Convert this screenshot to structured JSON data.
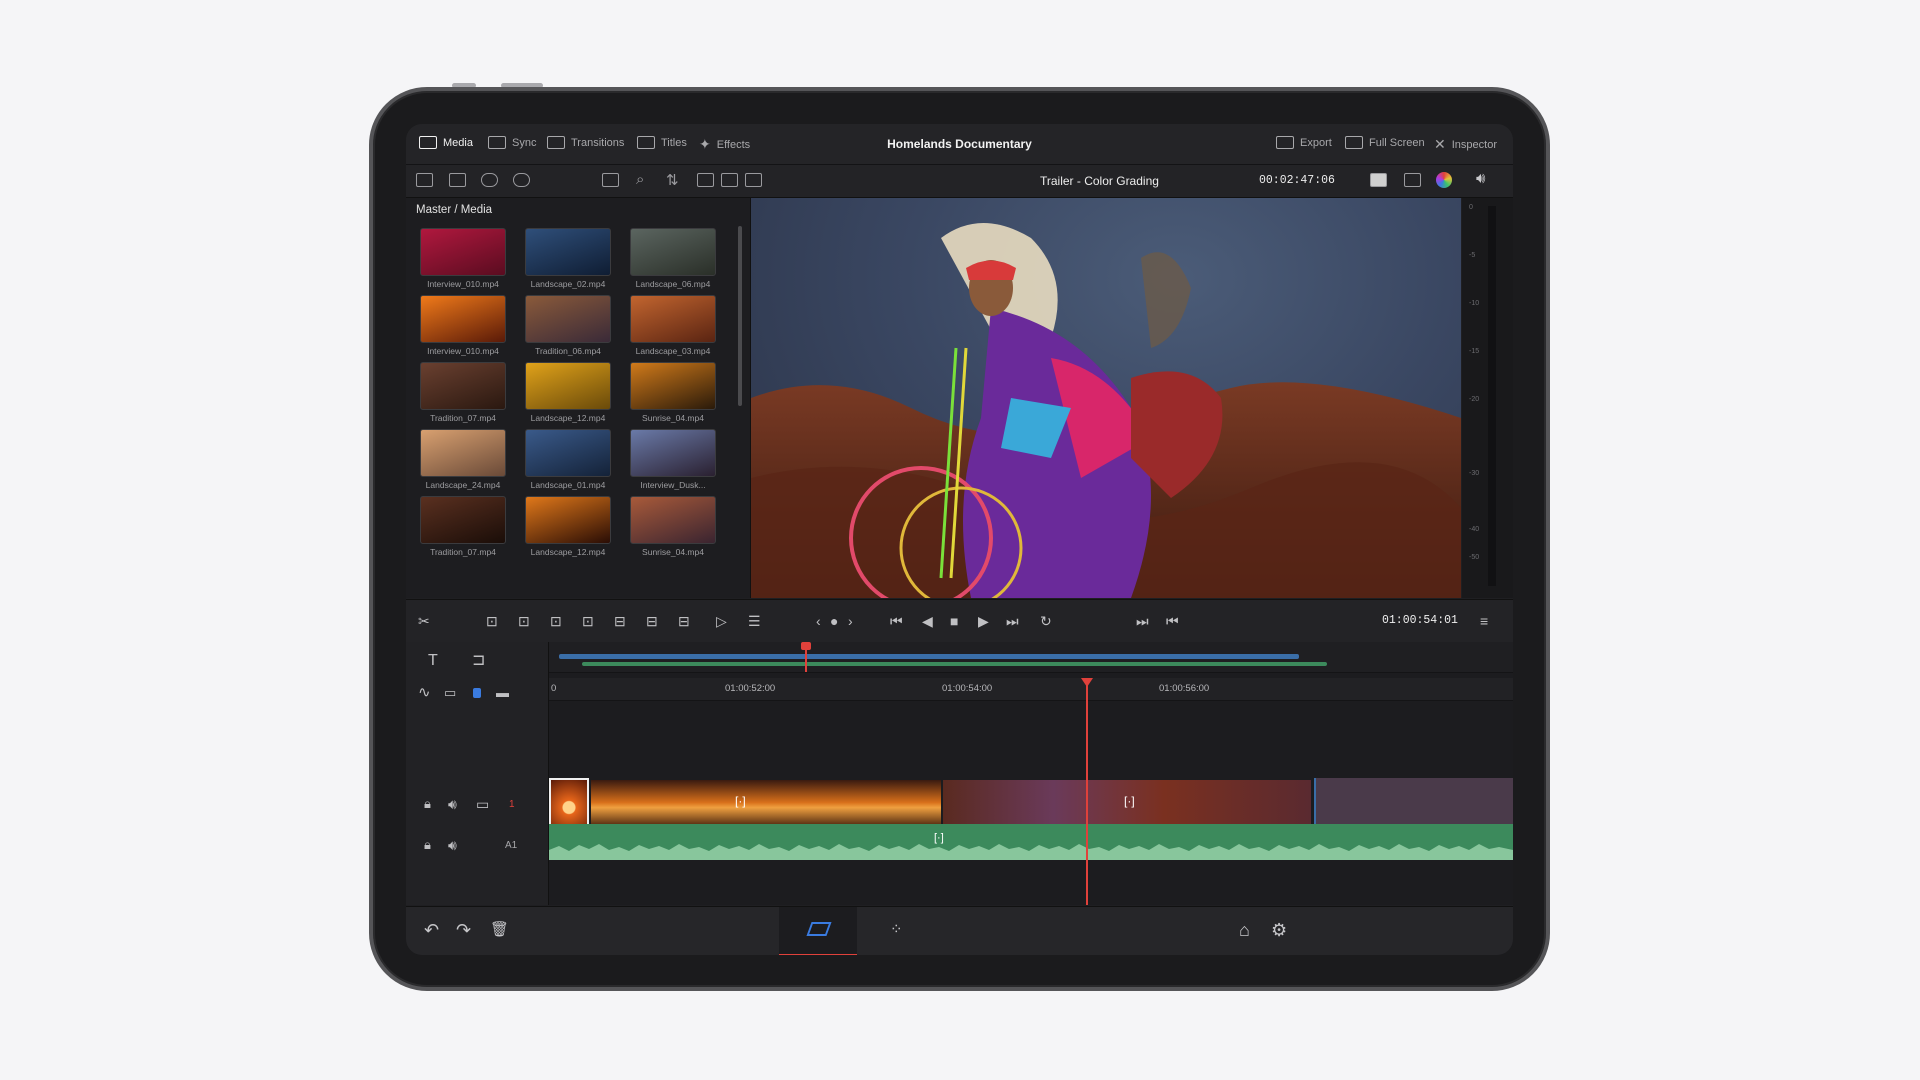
{
  "app": {
    "project_title": "Homelands Documentary",
    "tabs": [
      {
        "label": "Media",
        "icon": "media-icon",
        "active": true
      },
      {
        "label": "Sync",
        "icon": "sync-icon"
      },
      {
        "label": "Transitions",
        "icon": "transitions-icon"
      },
      {
        "label": "Titles",
        "icon": "titles-icon"
      },
      {
        "label": "Effects",
        "icon": "effects-icon"
      }
    ],
    "right_actions": [
      {
        "label": "Export",
        "icon": "export-icon"
      },
      {
        "label": "Full Screen",
        "icon": "fullscreen-icon"
      },
      {
        "label": "Inspector",
        "icon": "inspector-icon"
      }
    ]
  },
  "viewer": {
    "title": "Trailer - Color Grading",
    "timecode": "00:02:47:06",
    "audio_meter_labels": [
      "0",
      "-5",
      "-10",
      "-15",
      "-20",
      "-30",
      "-40",
      "-50"
    ]
  },
  "media_pool": {
    "breadcrumb": "Master / Media",
    "clips": [
      {
        "name": "Interview_010.mp4",
        "colors": [
          "#b0183e",
          "#5a0c20"
        ]
      },
      {
        "name": "Landscape_02.mp4",
        "colors": [
          "#2f4f7a",
          "#0f1d33"
        ]
      },
      {
        "name": "Landscape_06.mp4",
        "colors": [
          "#5b6560",
          "#2a2f28"
        ]
      },
      {
        "name": "Interview_010.mp4",
        "colors": [
          "#f07a1a",
          "#5a1a08"
        ]
      },
      {
        "name": "Tradition_06.mp4",
        "colors": [
          "#8a5a3a",
          "#3a2a38"
        ]
      },
      {
        "name": "Landscape_03.mp4",
        "colors": [
          "#c2652f",
          "#5a2412"
        ]
      },
      {
        "name": "Tradition_07.mp4",
        "colors": [
          "#6a4030",
          "#2a1810"
        ]
      },
      {
        "name": "Landscape_12.mp4",
        "colors": [
          "#e0a21a",
          "#6a4a0a"
        ]
      },
      {
        "name": "Sunrise_04.mp4",
        "colors": [
          "#d07a1a",
          "#2a1a0a"
        ]
      },
      {
        "name": "Landscape_24.mp4",
        "colors": [
          "#d8a070",
          "#6a4a38"
        ]
      },
      {
        "name": "Landscape_01.mp4",
        "colors": [
          "#3a5a8a",
          "#142238"
        ]
      },
      {
        "name": "Interview_Dusk...",
        "colors": [
          "#6a7aa8",
          "#2a2030"
        ]
      },
      {
        "name": "Tradition_07.mp4",
        "colors": [
          "#5a3020",
          "#1a0d08"
        ]
      },
      {
        "name": "Landscape_12.mp4",
        "colors": [
          "#e0781a",
          "#2a0d05"
        ]
      },
      {
        "name": "Sunrise_04.mp4",
        "colors": [
          "#a85a3a",
          "#3a2430"
        ]
      }
    ]
  },
  "transport": {
    "timecode": "01:00:54:01"
  },
  "timeline": {
    "ruler_labels": [
      "0",
      "01:00:52:00",
      "01:00:54:00",
      "01:00:56:00"
    ],
    "video_track_label": "1",
    "audio_track_label": "A1",
    "accent": "#e0413b",
    "audio_color": "#3c8a5c"
  }
}
